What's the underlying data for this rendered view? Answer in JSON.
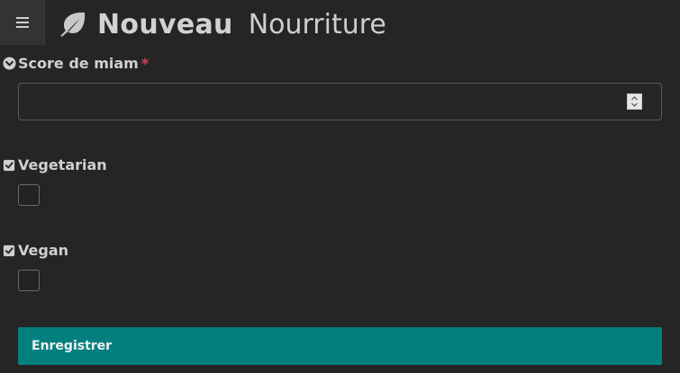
{
  "header": {
    "menu_icon": "hamburger-icon",
    "logo_icon": "leaf-icon",
    "title": "Nouveau",
    "subtitle": "Nourriture"
  },
  "form": {
    "fields": [
      {
        "label": "Score de miam",
        "required_marker": "*",
        "type": "number",
        "value": "",
        "label_icon": "chevron-circle-down-icon"
      },
      {
        "label": "Vegetarian",
        "type": "checkbox",
        "checked": false,
        "label_icon": "check-square-icon"
      },
      {
        "label": "Vegan",
        "type": "checkbox",
        "checked": false,
        "label_icon": "check-square-icon"
      }
    ],
    "submit_label": "Enregistrer"
  },
  "colors": {
    "background": "#252525",
    "accent": "#037f80",
    "required": "#e04055",
    "text": "#d0d0d0"
  }
}
